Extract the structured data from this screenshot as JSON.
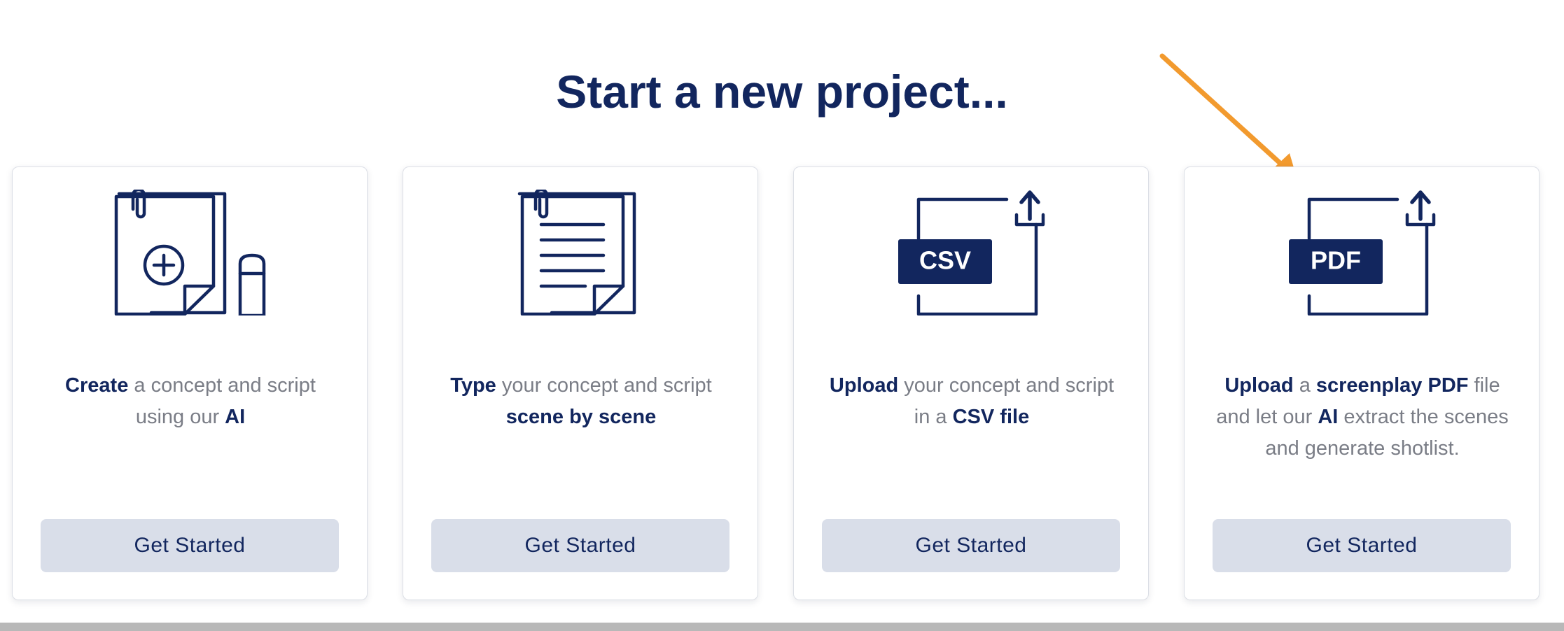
{
  "header": {
    "title": "Start a new project..."
  },
  "colors": {
    "navy": "#12265e",
    "button_bg": "#d9dee9",
    "arrow": "#f29a2e",
    "muted_text": "#7a7d86"
  },
  "cards": [
    {
      "icon": "document-add-pencil-icon",
      "desc": [
        {
          "t": "Create",
          "b": true
        },
        {
          "t": " a concept and script using our ",
          "b": false
        },
        {
          "t": "AI",
          "b": true
        }
      ],
      "button": "Get Started"
    },
    {
      "icon": "lined-document-icon",
      "desc": [
        {
          "t": "Type",
          "b": true
        },
        {
          "t": " your concept and script ",
          "b": false
        },
        {
          "t": "scene by scene",
          "b": true
        }
      ],
      "button": "Get Started"
    },
    {
      "icon": "csv-upload-icon",
      "badge": "CSV",
      "desc": [
        {
          "t": "Upload",
          "b": true
        },
        {
          "t": " your concept and script in a ",
          "b": false
        },
        {
          "t": "CSV file",
          "b": true
        }
      ],
      "button": "Get Started"
    },
    {
      "icon": "pdf-upload-icon",
      "badge": "PDF",
      "desc": [
        {
          "t": "Upload",
          "b": true
        },
        {
          "t": " a ",
          "b": false
        },
        {
          "t": "screenplay PDF",
          "b": true
        },
        {
          "t": " file and let our ",
          "b": false
        },
        {
          "t": "AI",
          "b": true
        },
        {
          "t": " extract the scenes and generate shotlist.",
          "b": false
        }
      ],
      "button": "Get Started"
    }
  ]
}
